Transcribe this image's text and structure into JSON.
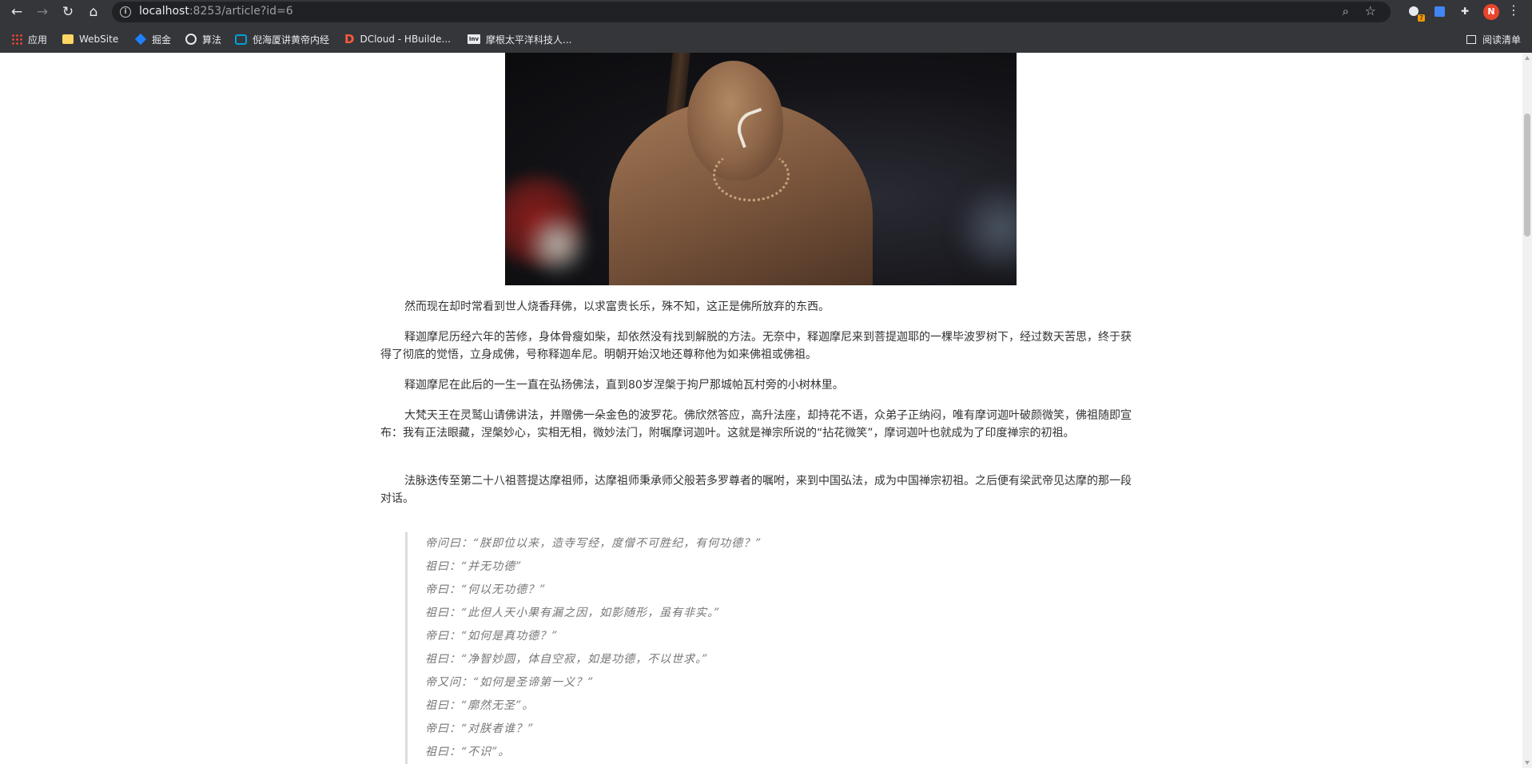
{
  "browser": {
    "url_host": "localhost",
    "url_rest": ":8253/article?id=6",
    "ext_badge": "7",
    "profile_initial": "N",
    "bookmarks": [
      {
        "label": "应用",
        "icon": "apps-grid-icon"
      },
      {
        "label": "WebSite",
        "icon": "folder-icon"
      },
      {
        "label": "掘金",
        "icon": "juejin-icon"
      },
      {
        "label": "算法",
        "icon": "globe-icon"
      },
      {
        "label": "倪海厦讲黄帝内经",
        "icon": "bilibili-icon"
      },
      {
        "label": "DCloud - HBuilde...",
        "icon": "dcloud-icon"
      },
      {
        "label": "摩根太平洋科技人...",
        "icon": "inv-icon"
      }
    ],
    "reading_list": "阅读清单"
  },
  "article": {
    "paragraphs": [
      "然而现在却时常看到世人烧香拜佛，以求富贵长乐，殊不知，这正是佛所放弃的东西。",
      "释迦摩尼历经六年的苦修，身体骨瘦如柴，却依然没有找到解脱的方法。无奈中，释迦摩尼来到菩提迦耶的一棵毕波罗树下，经过数天苦思，终于获得了彻底的觉悟，立身成佛，号称释迦牟尼。明朝开始汉地还尊称他为如来佛祖或佛祖。",
      "释迦摩尼在此后的一生一直在弘扬佛法，直到80岁涅槃于拘尸那城帕瓦村旁的小树林里。",
      "大梵天王在灵鹫山请佛讲法，并赠佛一朵金色的波罗花。佛欣然答应，高升法座，却持花不语，众弟子正纳闷，唯有摩诃迦叶破颜微笑，佛祖随即宣布：我有正法眼藏，涅槃妙心，实相无相，微妙法门，附嘱摩诃迦叶。这就是禅宗所说的“拈花微笑”，摩诃迦叶也就成为了印度禅宗的初祖。",
      "法脉迭传至第二十八祖菩提达摩祖师，达摩祖师秉承师父般若多罗尊者的嘱咐，来到中国弘法，成为中国禅宗初祖。之后便有梁武帝见达摩的那一段对话。"
    ],
    "quote_lines": [
      "帝问曰：“朕即位以来，造寺写经，度僧不可胜纪，有何功德？”",
      "祖曰：“并无功德”",
      "帝曰：“何以无功德？”",
      "祖曰：“此但人天小果有漏之因，如影随形，虽有非实。”",
      "帝曰：“如何是真功德？”",
      "祖曰：“净智妙圆，体自空寂，如是功德，不以世求。”",
      "帝又问：“如何是圣谛第一义？”",
      "祖曰：“廓然无圣”。",
      "帝曰：“对朕者谁？”",
      "祖曰：“不识”。"
    ]
  }
}
